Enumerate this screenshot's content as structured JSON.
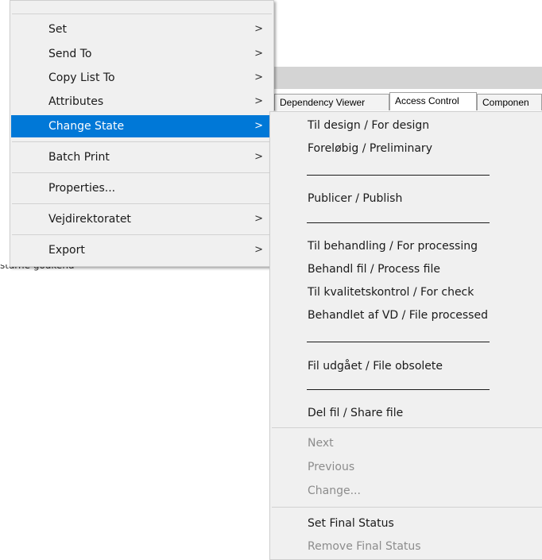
{
  "left_menu": {
    "items": [
      {
        "label": "Set",
        "arrow": ">"
      },
      {
        "label": "Send To",
        "arrow": ">"
      },
      {
        "label": "Copy List To",
        "arrow": ">"
      },
      {
        "label": "Attributes",
        "arrow": ">"
      },
      {
        "label": "Change State",
        "arrow": ">"
      },
      {
        "label": "Batch Print",
        "arrow": ">"
      },
      {
        "label": "Properties...",
        "arrow": ""
      },
      {
        "label": "Vejdirektoratet",
        "arrow": ">"
      },
      {
        "label": "Export",
        "arrow": ">"
      }
    ]
  },
  "background_tabs": [
    "Dependency Viewer",
    "Access Control",
    "Componen"
  ],
  "under_text": "starne godkend",
  "right_menu": {
    "items": [
      {
        "label": "Til design / For design"
      },
      {
        "label": "Foreløbig / Preliminary"
      },
      {
        "label": "Publicer / Publish"
      },
      {
        "label": "Til behandling / For processing"
      },
      {
        "label": "Behandl fil / Process file"
      },
      {
        "label": "Til kvalitetskontrol / For check"
      },
      {
        "label": "Behandlet af VD / File processed"
      },
      {
        "label": "Fil udgået / File obsolete"
      },
      {
        "label": "Del fil / Share file"
      },
      {
        "label": "Next"
      },
      {
        "label": "Previous"
      },
      {
        "label": "Change..."
      },
      {
        "label": "Set Final Status"
      },
      {
        "label": "Remove Final Status"
      }
    ]
  },
  "colors": {
    "menu_bg": "#f0f0f0",
    "highlight": "#0078d7",
    "disabled_text": "#8c8c8c"
  }
}
